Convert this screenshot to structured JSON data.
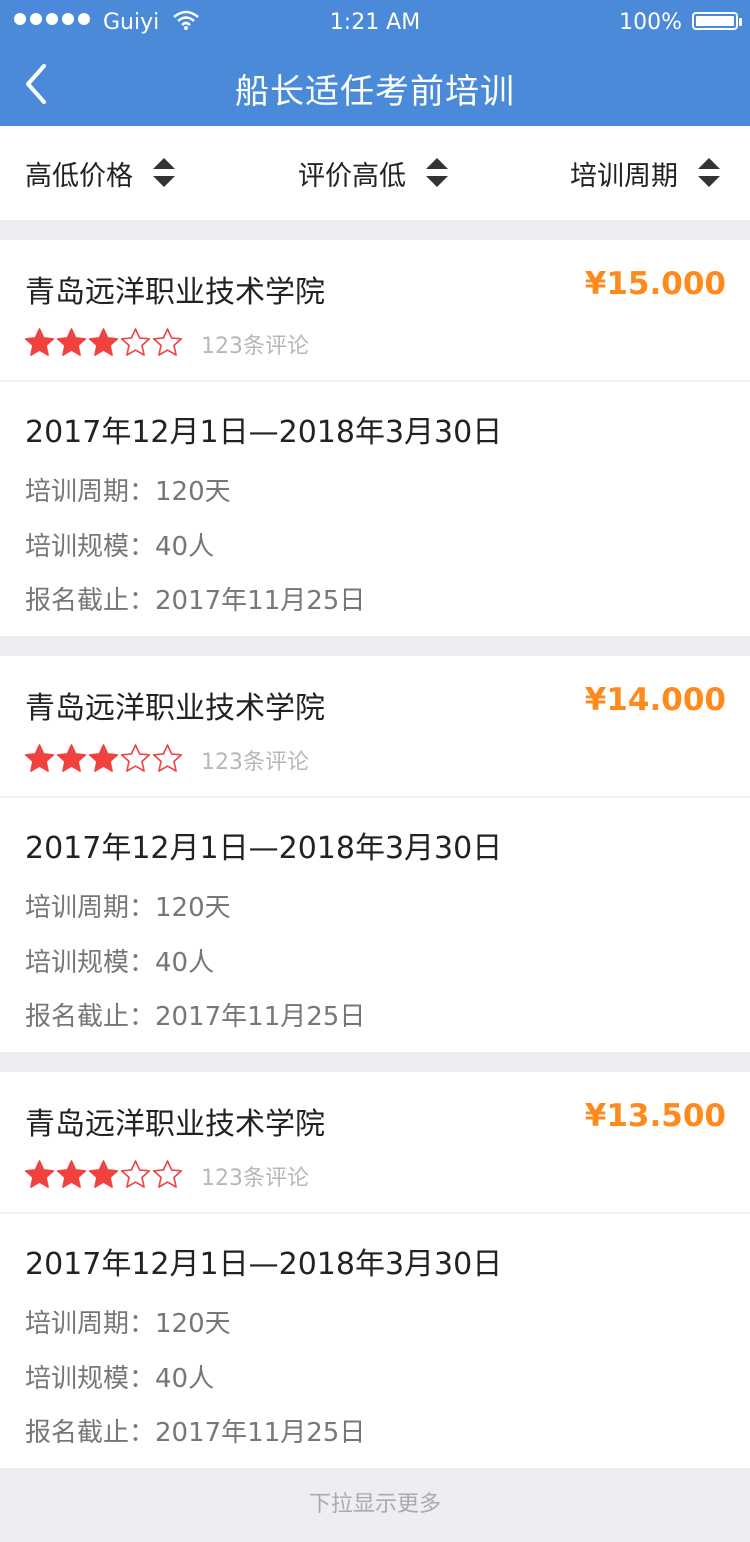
{
  "status_bar": {
    "carrier": "Guiyi",
    "time": "1:21 AM",
    "battery": "100%"
  },
  "nav": {
    "title": "船长适任考前培训"
  },
  "filters": [
    {
      "label": "高低价格"
    },
    {
      "label": "评价高低"
    },
    {
      "label": "培训周期"
    }
  ],
  "courses": [
    {
      "name": "青岛远洋职业技术学院",
      "price": "¥15.000",
      "rating": 3,
      "rating_max": 5,
      "reviews": "123条评论",
      "dates": "2017年12月1日—2018年3月30日",
      "period_label": "培训周期：",
      "period": "120天",
      "scale_label": "培训规模：",
      "scale": "40人",
      "deadline_label": "报名截止：",
      "deadline": "2017年11月25日"
    },
    {
      "name": "青岛远洋职业技术学院",
      "price": "¥14.000",
      "rating": 3,
      "rating_max": 5,
      "reviews": "123条评论",
      "dates": "2017年12月1日—2018年3月30日",
      "period_label": "培训周期：",
      "period": "120天",
      "scale_label": "培训规模：",
      "scale": "40人",
      "deadline_label": "报名截止：",
      "deadline": "2017年11月25日"
    },
    {
      "name": "青岛远洋职业技术学院",
      "price": "¥13.500",
      "rating": 3,
      "rating_max": 5,
      "reviews": "123条评论",
      "dates": "2017年12月1日—2018年3月30日",
      "period_label": "培训周期：",
      "period": "120天",
      "scale_label": "培训规模：",
      "scale": "40人",
      "deadline_label": "报名截止：",
      "deadline": "2017年11月25日"
    }
  ],
  "footer": {
    "text": "下拉显示更多"
  },
  "colors": {
    "header": "#4a8ad8",
    "price": "#ff8a1c",
    "star": "#f0433f"
  }
}
